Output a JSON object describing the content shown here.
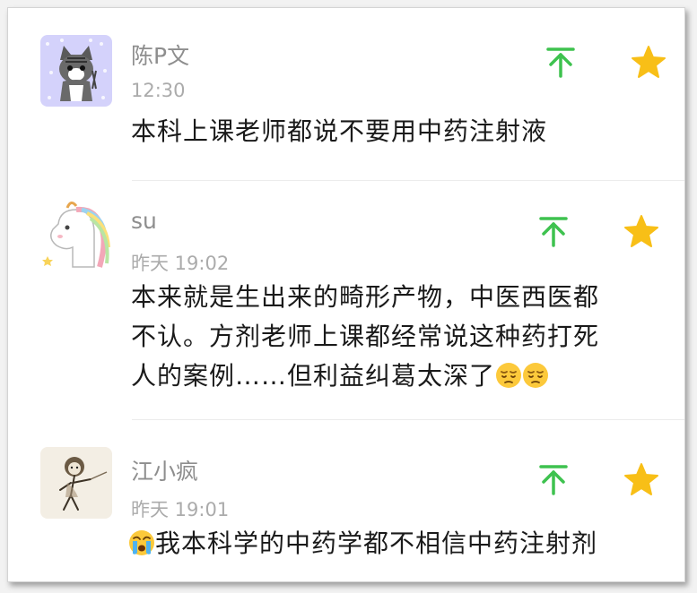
{
  "comments": [
    {
      "user": "陈P文",
      "time": "12:30",
      "text": "本科上课老师都说不要用中药注射液"
    },
    {
      "user": "su",
      "time": "昨天 19:02",
      "text_lines": [
        "本来就是生出来的畸形产物，中医西医都",
        "不认。方剂老师上课都经常说这种药打死",
        "人的案例……但利益纠葛太深了"
      ],
      "trailing_emoji": [
        "pensive-face-icon",
        "pensive-face-icon"
      ]
    },
    {
      "user": "江小疯",
      "time": "昨天 19:01",
      "leading_emoji": "loudly-crying-face-icon",
      "text": "我本科学的中药学都不相信中药注射剂"
    }
  ],
  "icons": {
    "pin_top": "arrow-up-to-top-icon",
    "favorite": "star-icon"
  },
  "colors": {
    "pin_green": "#3ec24f",
    "star_gold": "#f8bf17",
    "username": "#8e8e8e",
    "time": "#ababab",
    "content": "#1a1a1a"
  }
}
